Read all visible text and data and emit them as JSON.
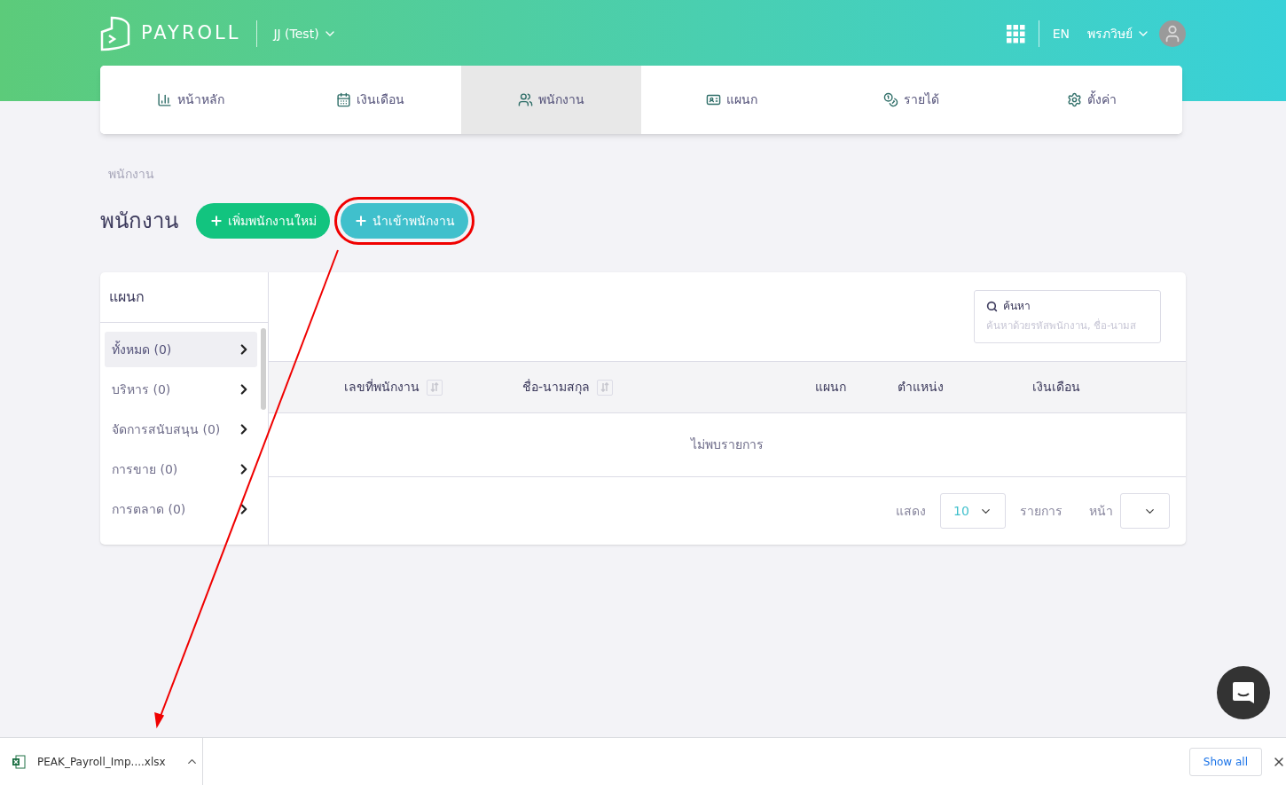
{
  "header": {
    "logo": "PAYROLL",
    "company": "JJ (Test)",
    "language": "EN",
    "user": "พรภวิษย์"
  },
  "tabs": [
    {
      "label": "หน้าหลัก",
      "selected": false
    },
    {
      "label": "เงินเดือน",
      "selected": false
    },
    {
      "label": "พนักงาน",
      "selected": true
    },
    {
      "label": "แผนก",
      "selected": false
    },
    {
      "label": "รายได้",
      "selected": false
    },
    {
      "label": "ตั้งค่า",
      "selected": false
    }
  ],
  "breadcrumb": "พนักงาน",
  "page_title": "พนักงาน",
  "actions": [
    {
      "label": "เพิ่มพนักงานใหม่",
      "kind": "add",
      "highlighted": false
    },
    {
      "label": "นำเข้าพนักงาน",
      "kind": "import",
      "highlighted": true
    }
  ],
  "departments": {
    "title": "แผนก",
    "items": [
      {
        "label": "ทั้งหมด (0)",
        "selected": true
      },
      {
        "label": "บริหาร (0)",
        "selected": false
      },
      {
        "label": "จัดการสนับสนุน (0)",
        "selected": false
      },
      {
        "label": "การขาย (0)",
        "selected": false
      },
      {
        "label": "การตลาด (0)",
        "selected": false
      }
    ]
  },
  "search": {
    "label": "ค้นหา",
    "placeholder": "ค้นหาด้วยรหัสพนักงาน, ชื่อ-นามส"
  },
  "table": {
    "columns": [
      {
        "label": "เลขที่พนักงาน",
        "sortable": true
      },
      {
        "label": "ชื่อ-นามสกุล",
        "sortable": true
      },
      {
        "label": "แผนก",
        "sortable": false
      },
      {
        "label": "ตำแหน่ง",
        "sortable": false
      },
      {
        "label": "เงินเดือน",
        "sortable": false
      }
    ],
    "empty": "ไม่พบรายการ"
  },
  "pagination": {
    "show_label": "แสดง",
    "page_size": "10",
    "rows_label": "รายการ",
    "page_label": "หน้า"
  },
  "download_bar": {
    "file": "PEAK_Payroll_Imp....xlsx",
    "show_all": "Show all"
  }
}
